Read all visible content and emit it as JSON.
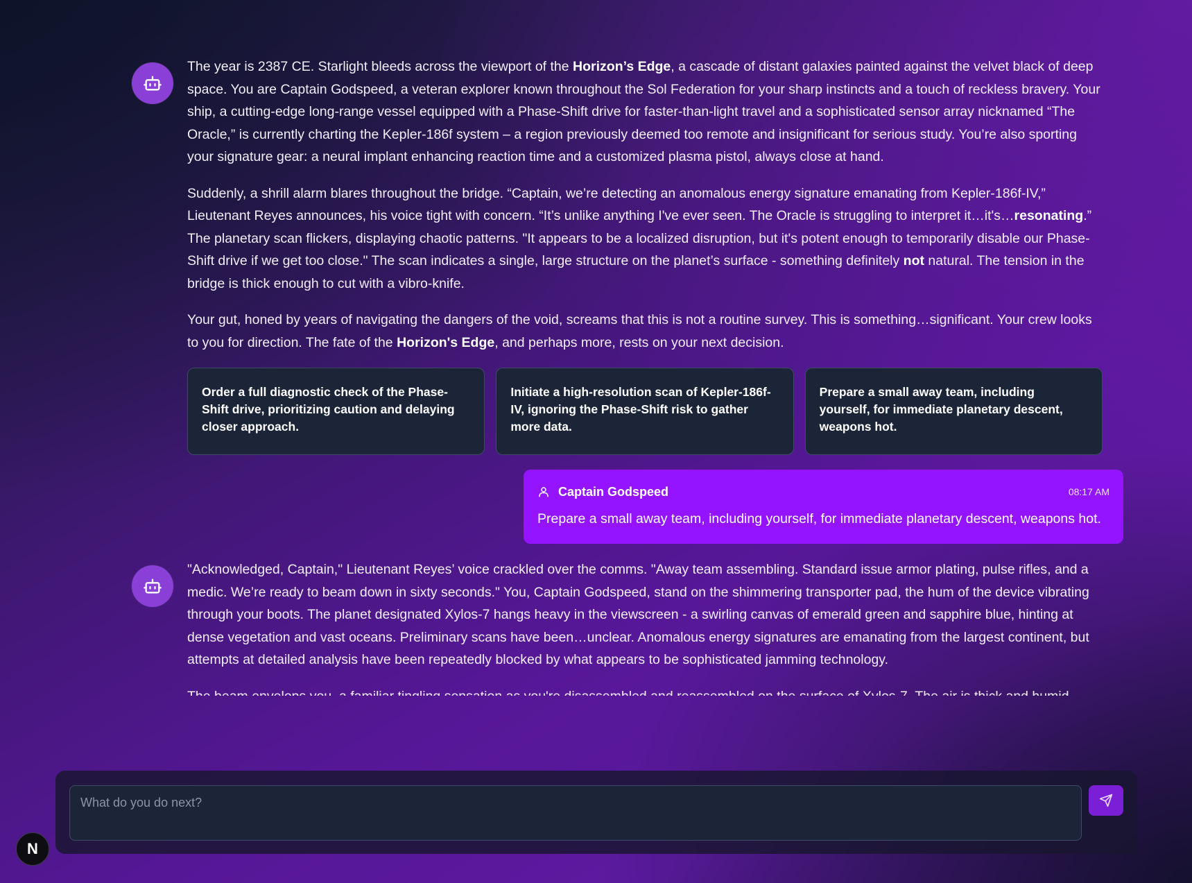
{
  "messages": [
    {
      "role": "assistant",
      "avatar_icon": "bot-icon",
      "paragraphs": [
        [
          "The year is 2387 CE. Starlight bleeds across the viewport of the ",
          {
            "b": "Horizon’s Edge"
          },
          ", a cascade of distant galaxies painted against the velvet black of deep space. You are Captain Godspeed, a veteran explorer known throughout the Sol Federation for your sharp instincts and a touch of reckless bravery. Your ship, a cutting-edge long-range vessel equipped with a Phase-Shift drive for faster-than-light travel and a sophisticated sensor array nicknamed “The Oracle,” is currently charting the Kepler-186f system – a region previously deemed too remote and insignificant for serious study. You’re also sporting your signature gear: a neural implant enhancing reaction time and a customized plasma pistol, always close at hand."
        ],
        [
          "Suddenly, a shrill alarm blares throughout the bridge. “Captain, we’re detecting an anomalous energy signature emanating from Kepler-186f-IV,” Lieutenant Reyes announces, his voice tight with concern. “It’s unlike anything I've ever seen. The Oracle is struggling to interpret it…it's…",
          {
            "b": "resonating"
          },
          ".” The planetary scan flickers, displaying chaotic patterns. \"It appears to be a localized disruption, but it's potent enough to temporarily disable our Phase-Shift drive if we get too close.\" The scan indicates a single, large structure on the planet’s surface - something definitely ",
          {
            "b": "not"
          },
          " natural. The tension in the bridge is thick enough to cut with a vibro-knife."
        ],
        [
          "Your gut, honed by years of navigating the dangers of the void, screams that this is not a routine survey. This is something…significant. Your crew looks to you for direction. The fate of the ",
          {
            "b": "Horizon's Edge"
          },
          ", and perhaps more, rests on your next decision."
        ]
      ],
      "choices": [
        "Order a full diagnostic check of the Phase-Shift drive, prioritizing caution and delaying closer approach.",
        "Initiate a high-resolution scan of Kepler-186f-IV, ignoring the Phase-Shift risk to gather more data.",
        "Prepare a small away team, including yourself, for immediate planetary descent, weapons hot."
      ]
    },
    {
      "role": "user",
      "user_icon": "user-icon",
      "name": "Captain Godspeed",
      "time": "08:17 AM",
      "text": "Prepare a small away team, including yourself, for immediate planetary descent, weapons hot."
    },
    {
      "role": "assistant",
      "avatar_icon": "bot-icon",
      "paragraphs": [
        [
          "\"Acknowledged, Captain,\" Lieutenant Reyes’ voice crackled over the comms. \"Away team assembling. Standard issue armor plating, pulse rifles, and a medic. We’re ready to beam down in sixty seconds.\" You, Captain Godspeed, stand on the shimmering transporter pad, the hum of the device vibrating through your boots. The planet designated Xylos-7 hangs heavy in the viewscreen - a swirling canvas of emerald green and sapphire blue, hinting at dense vegetation and vast oceans. Preliminary scans have been…unclear. Anomalous energy signatures are emanating from the largest continent, but attempts at detailed analysis have been repeatedly blocked by what appears to be sophisticated jamming technology."
        ],
        [
          "The beam envelops you, a familiar tingling sensation as you're disassembled and reassembled on the surface of Xylos-7. The air is thick and humid"
        ]
      ]
    }
  ],
  "composer": {
    "placeholder": "What do you do next?",
    "value": "",
    "send_icon": "send-icon"
  },
  "badge": {
    "letter": "N"
  },
  "colors": {
    "user_bubble": "#9414ff",
    "avatar": "#8a3fd6",
    "card": "#1c2538",
    "send_button": "#7b1fd6"
  }
}
